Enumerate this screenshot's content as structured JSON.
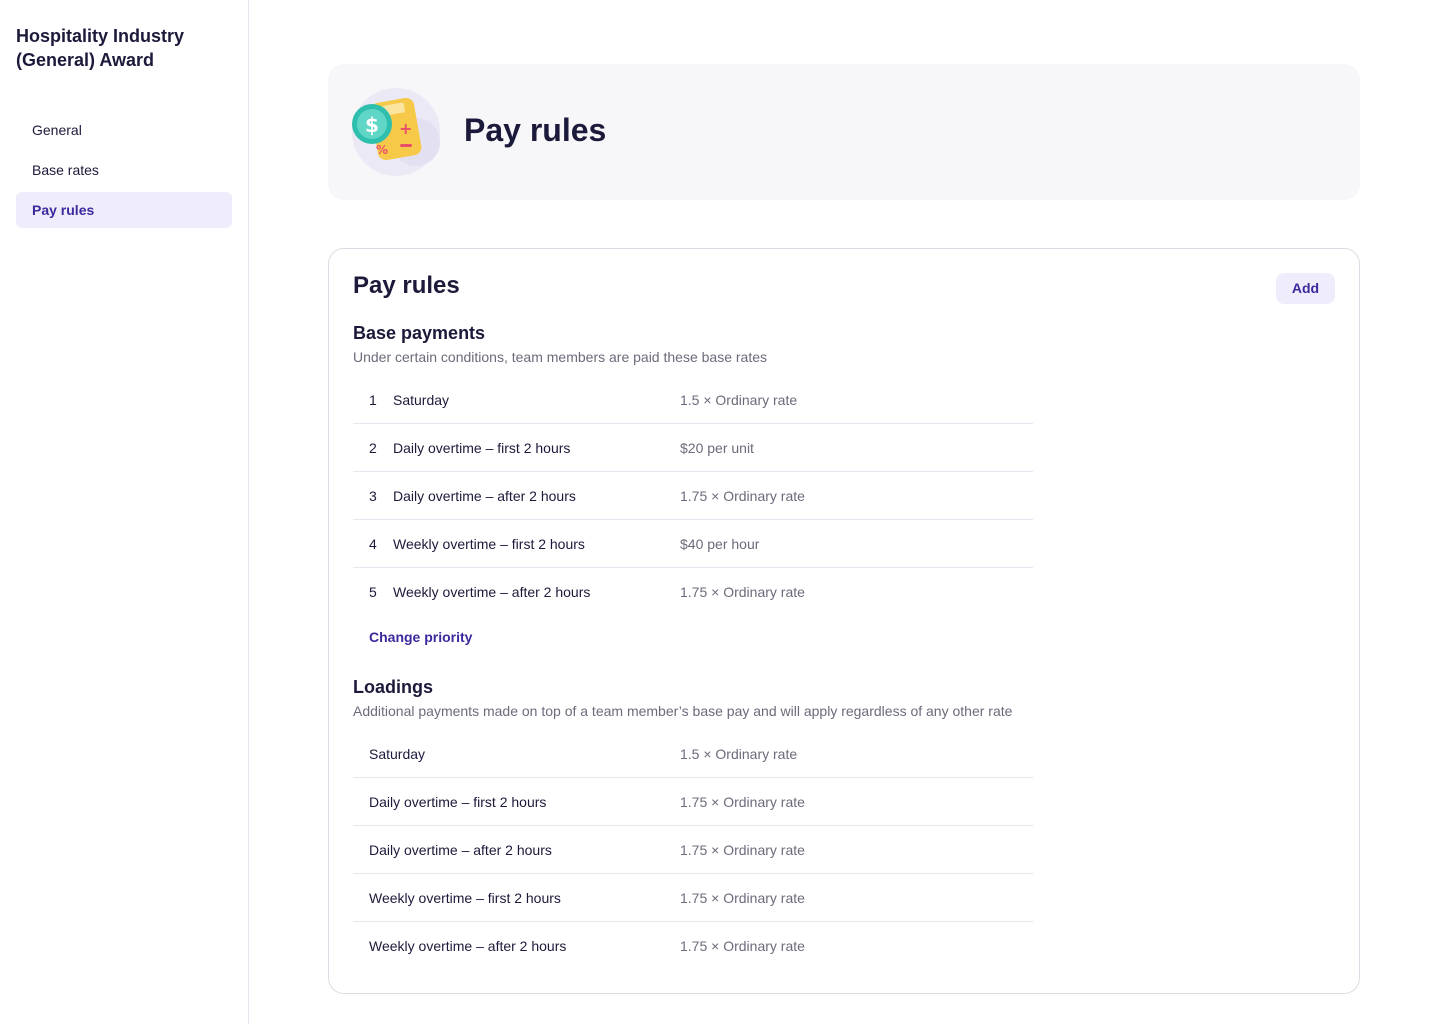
{
  "sidebar": {
    "title": "Hospitality Industry (General) Award",
    "items": [
      {
        "label": "General",
        "active": false
      },
      {
        "label": "Base rates",
        "active": false
      },
      {
        "label": "Pay rules",
        "active": true
      }
    ]
  },
  "hero": {
    "title": "Pay rules",
    "icon": "calculator-coin-icon"
  },
  "card": {
    "title": "Pay rules",
    "add_label": "Add",
    "base_payments": {
      "title": "Base payments",
      "description": "Under certain conditions, team members are paid these base rates",
      "rows": [
        {
          "index": "1",
          "name": "Saturday",
          "rate": "1.5 × Ordinary rate"
        },
        {
          "index": "2",
          "name": "Daily overtime – first 2 hours",
          "rate": "$20 per unit"
        },
        {
          "index": "3",
          "name": "Daily overtime – after 2 hours",
          "rate": "1.75 × Ordinary rate"
        },
        {
          "index": "4",
          "name": "Weekly overtime – first 2 hours",
          "rate": "$40 per hour"
        },
        {
          "index": "5",
          "name": "Weekly overtime – after 2 hours",
          "rate": "1.75 × Ordinary rate"
        }
      ],
      "change_priority_label": "Change priority"
    },
    "loadings": {
      "title": "Loadings",
      "description": "Additional payments made on top of a team member’s base pay and will apply regardless of any other rate",
      "rows": [
        {
          "name": "Saturday",
          "rate": "1.5 × Ordinary rate"
        },
        {
          "name": "Daily overtime – first 2 hours",
          "rate": "1.75 × Ordinary rate"
        },
        {
          "name": "Daily overtime – after 2 hours",
          "rate": "1.75 × Ordinary rate"
        },
        {
          "name": "Weekly overtime – first 2 hours",
          "rate": "1.75 × Ordinary rate"
        },
        {
          "name": "Weekly overtime – after 2 hours",
          "rate": "1.75 × Ordinary rate"
        }
      ]
    }
  },
  "colors": {
    "accent": "#3b2a9e",
    "accent_bg": "#efedfb",
    "text": "#1c1a3a",
    "muted": "#6b6b7b"
  }
}
